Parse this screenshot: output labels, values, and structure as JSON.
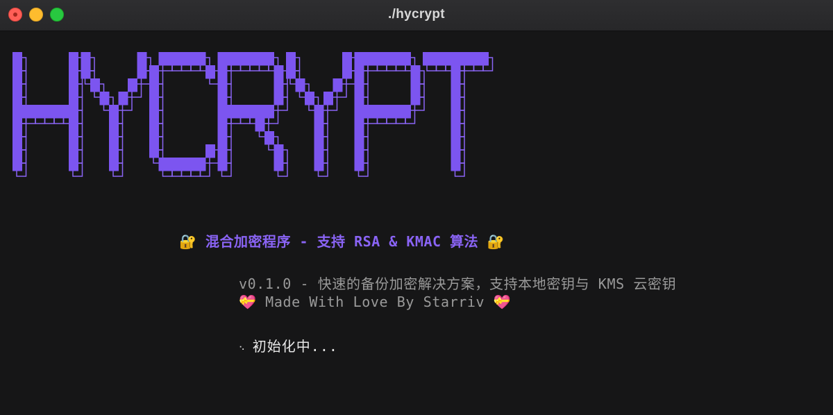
{
  "window": {
    "title": "./hycrypt"
  },
  "banner": {
    "text": "HYCRYPT",
    "color": "#7c55f0",
    "outline_color": "#8a64f5"
  },
  "tagline": {
    "lock_icon_left": "🔐",
    "text": "混合加密程序 - 支持 RSA & KMAC 算法",
    "lock_icon_right": "🔐"
  },
  "info": {
    "version_line": "v0.1.0 - 快速的备份加密解决方案，支持本地密钥与 KMS 云密钥",
    "heart_icon": "💝",
    "credit_text": "Made With Love By Starriv"
  },
  "status": {
    "spinner": "⠢",
    "text": "初始化中..."
  }
}
